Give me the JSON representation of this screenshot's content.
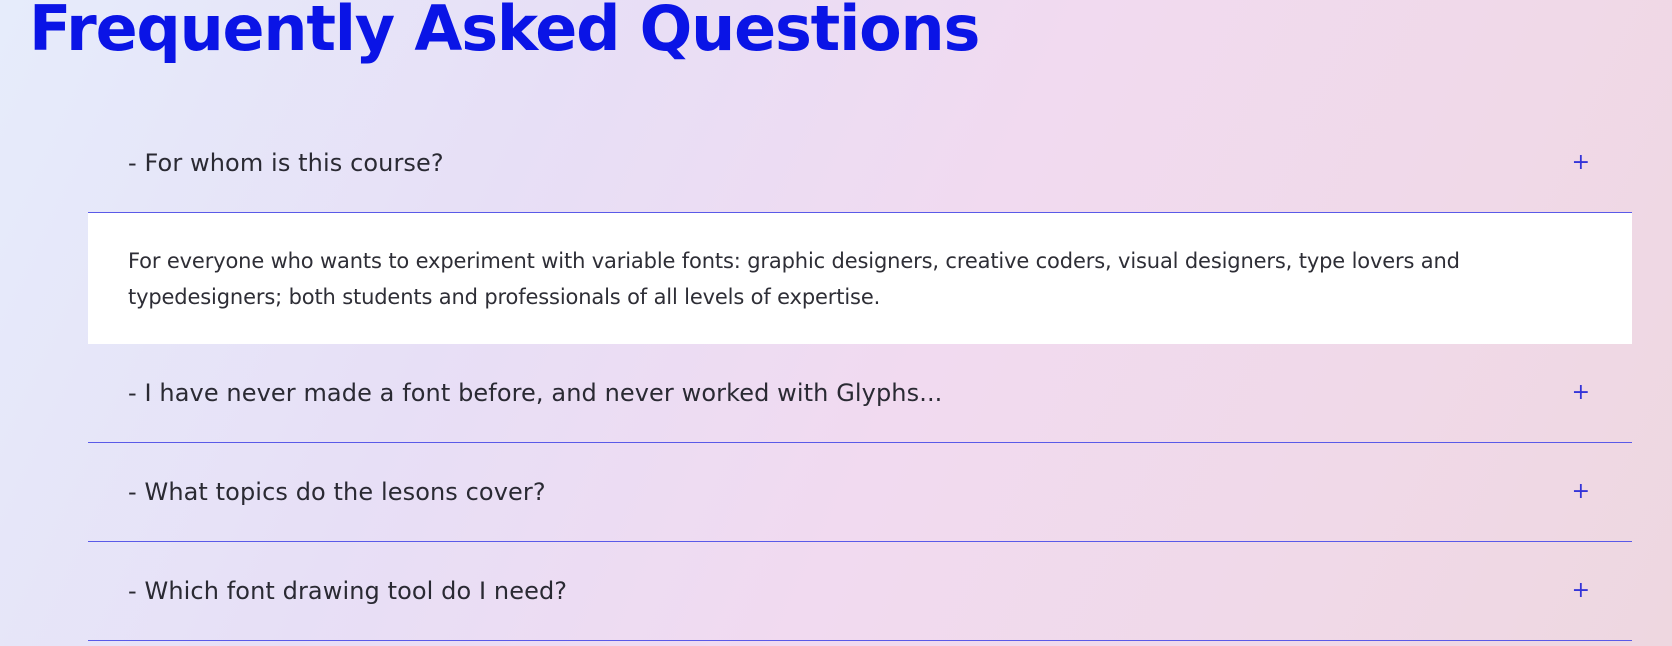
{
  "page": {
    "title": "Frequently Asked Questions"
  },
  "faq": {
    "items": [
      {
        "question": "- For whom is this course?",
        "toggle": "+",
        "expanded": true,
        "answer": "For everyone who wants to experiment with variable fonts: graphic designers, creative coders, visual designers, type lovers and typedesigners; both students and professionals of all levels of expertise."
      },
      {
        "question": "- I have never made a font before, and never worked with Glyphs...",
        "toggle": "+",
        "expanded": false
      },
      {
        "question": "- What topics do the lesons cover?",
        "toggle": "+",
        "expanded": false
      },
      {
        "question": "- Which font drawing tool do I need?",
        "toggle": "+",
        "expanded": false
      }
    ]
  },
  "colors": {
    "title": "#0a14e6",
    "divider": "#5a5ae8",
    "toggle": "#3434d8",
    "answer_background": "#ffffff"
  }
}
